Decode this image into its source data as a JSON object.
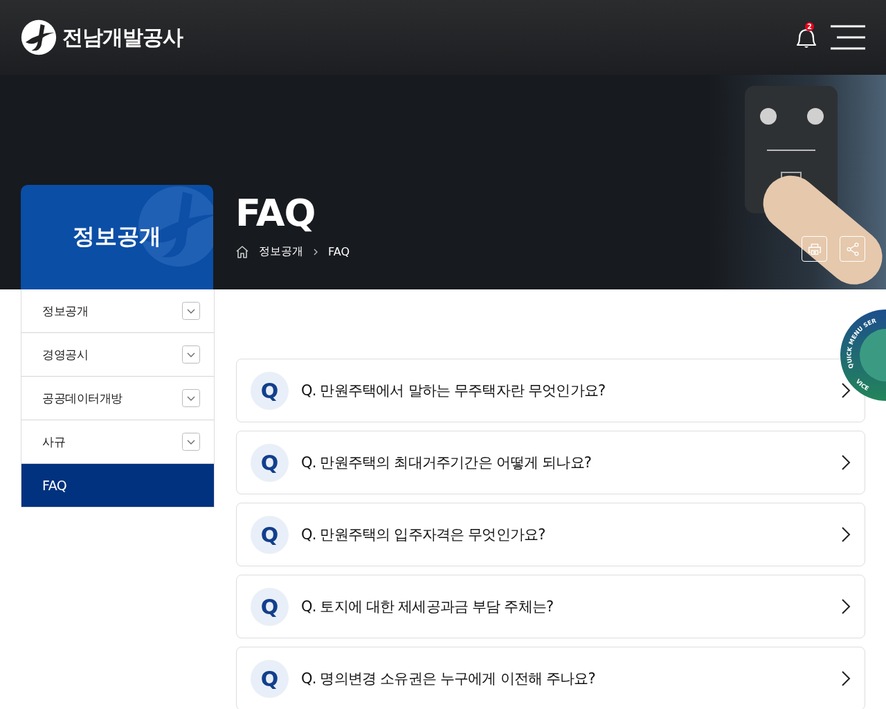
{
  "header": {
    "logo_text": "전남개발공사",
    "notification_count": "2"
  },
  "hero": {
    "section_title": "정보공개",
    "page_title": "FAQ",
    "breadcrumb": [
      "정보공개",
      "FAQ"
    ]
  },
  "sidebar": {
    "items": [
      {
        "label": "정보공개",
        "selected": false,
        "expandable": true
      },
      {
        "label": "경영공시",
        "selected": false,
        "expandable": true
      },
      {
        "label": "공공데이터개방",
        "selected": false,
        "expandable": true
      },
      {
        "label": "사규",
        "selected": false,
        "expandable": true
      },
      {
        "label": "FAQ",
        "selected": true,
        "expandable": false
      }
    ]
  },
  "faq": {
    "items": [
      {
        "mark": "Q",
        "question": "Q. 만원주택에서 말하는 무주택자란 무엇인가요?"
      },
      {
        "mark": "Q",
        "question": "Q. 만원주택의 최대거주기간은 어떻게 되나요?"
      },
      {
        "mark": "Q",
        "question": "Q. 만원주택의 입주자격은 무엇인가요?"
      },
      {
        "mark": "Q",
        "question": "Q. 토지에 대한 제세공과금 부담 주체는?"
      },
      {
        "mark": "Q",
        "question": "Q. 명의변경 소유권은 누구에게 이전해 주나요?"
      }
    ]
  },
  "quick_menu": {
    "top_text": "QUICK MENU SER",
    "bottom_text": "VICE"
  }
}
